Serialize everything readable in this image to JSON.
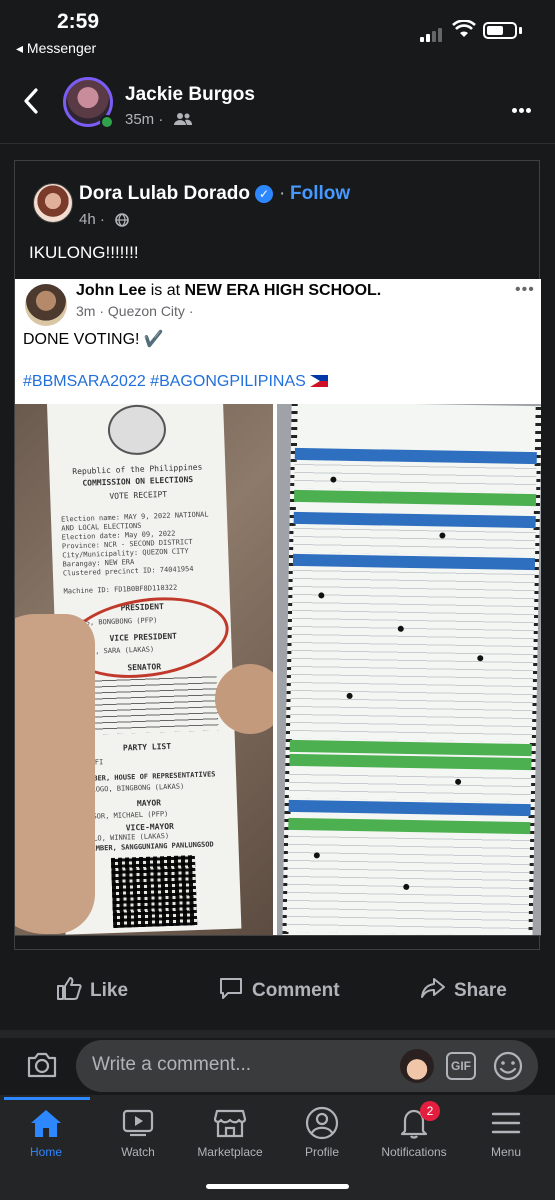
{
  "status_bar": {
    "time": "2:59",
    "back_app": "◂ Messenger"
  },
  "header": {
    "name": "Jackie Burgos",
    "time": "35m ·"
  },
  "shared_post": {
    "author": "Dora Lulab Dorado",
    "follow_label": "Follow",
    "time": "4h ·",
    "text": "IKULONG!!!!!!!",
    "embedded": {
      "author": "John Lee",
      "at_text": "is at",
      "location": "NEW ERA HIGH SCHOOL.",
      "time": "3m · Quezon City ·",
      "text": "DONE VOTING! ✔️",
      "hashtags": "#BBMSARA2022 #BAGONGPILIPINAS",
      "receipt": {
        "republic": "Republic of the Philippines",
        "commission": "COMMISSION ON ELECTIONS",
        "vote_receipt": "VOTE RECEIPT",
        "lines": [
          "Election name: MAY 9, 2022 NATIONAL",
          "AND LOCAL ELECTIONS",
          "Election date: May 09, 2022",
          "Province: NCR - SECOND DISTRICT",
          "City/Municipality: QUEZON CITY",
          "Barangay: NEW ERA",
          "Clustered precinct ID: 74041954",
          "Machine ID: FD1B0BF8D110322"
        ],
        "president_label": "PRESIDENT",
        "president": "MARCOS, BONGBONG (PFP)",
        "vp_label": "VICE PRESIDENT",
        "vp": "DUTERTE, SARA (LAKAS)",
        "senator_label": "SENATOR",
        "party_list_label": "PARTY LIST",
        "party_list": "148 WIFI",
        "house_label": "MEMBER, HOUSE OF REPRESENTATIVES",
        "house": "CRISOLOGO, BINGBONG (LAKAS)",
        "mayor_label": "MAYOR",
        "mayor": "DEFENSOR, MICHAEL (PFP)",
        "vice_mayor_label": "VICE-MAYOR",
        "vice_mayor": "CASTELO, WINNIE (LAKAS)",
        "council_label": "MEMBER, SANGGUNIANG PANLUNGSOD"
      }
    }
  },
  "actions": {
    "like": "Like",
    "comment": "Comment",
    "share": "Share"
  },
  "comment_bar": {
    "placeholder": "Write a comment...",
    "gif": "GIF"
  },
  "tabs": [
    {
      "label": "Home",
      "icon": "home-icon"
    },
    {
      "label": "Watch",
      "icon": "watch-icon"
    },
    {
      "label": "Marketplace",
      "icon": "marketplace-icon"
    },
    {
      "label": "Profile",
      "icon": "profile-icon"
    },
    {
      "label": "Notifications",
      "icon": "bell-icon",
      "badge": "2"
    },
    {
      "label": "Menu",
      "icon": "menu-icon"
    }
  ],
  "colors": {
    "background": "#18191a",
    "accent": "#2d88ff",
    "follow": "#4599ff",
    "badge": "#e41e3f"
  }
}
